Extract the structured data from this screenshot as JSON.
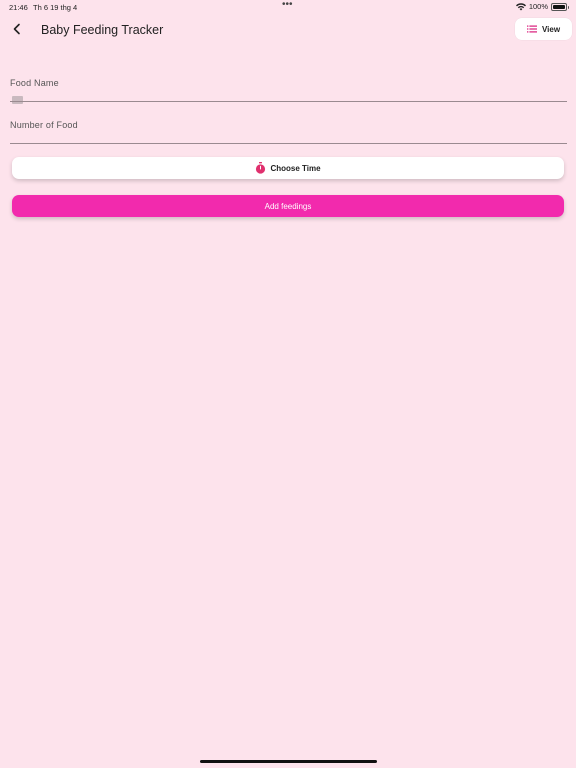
{
  "status_bar": {
    "time": "21:46",
    "date": "Th 6 19 thg 4",
    "dots": "•••",
    "battery": "100%"
  },
  "app_bar": {
    "title": "Baby Feeding Tracker",
    "view_label": "View"
  },
  "form": {
    "food_name_label": "Food Name",
    "food_name_value": "",
    "number_label": "Number of Food",
    "number_value": "",
    "choose_time_label": "Choose Time",
    "submit_label": "Add feedings"
  },
  "colors": {
    "background": "#fde3ec",
    "accent": "#f22aad",
    "timer_icon": "#e0306e"
  }
}
